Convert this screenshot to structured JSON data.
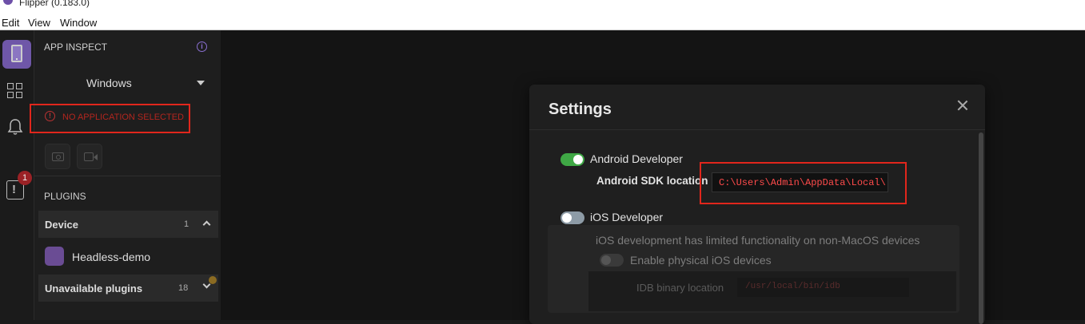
{
  "window": {
    "title": "Flipper (0.183.0)"
  },
  "menu": [
    "Edit",
    "View",
    "Window"
  ],
  "rail": {
    "badge_count": "1"
  },
  "sidebar": {
    "app_inspect_heading": "APP INSPECT",
    "selected_device": "Windows",
    "no_app_text": "NO APPLICATION SELECTED",
    "plugins_heading": "PLUGINS",
    "groups": [
      {
        "label": "Device",
        "count": "1"
      },
      {
        "label": "Unavailable plugins",
        "count": "18"
      }
    ],
    "plugins": [
      {
        "label": "Headless-demo"
      }
    ]
  },
  "settings": {
    "title": "Settings",
    "android": {
      "toggle_label": "Android Developer",
      "enabled": true,
      "sdk_label": "Android SDK location",
      "sdk_value": "C:\\Users\\Admin\\AppData\\Local\\"
    },
    "ios": {
      "toggle_label": "iOS Developer",
      "enabled": false,
      "note": "iOS development has limited functionality on non-MacOS devices",
      "physical_label": "Enable physical iOS devices",
      "idb_label": "IDB binary location",
      "idb_value": "/usr/local/bin/idb"
    }
  },
  "colors": {
    "accent": "#6f57a8",
    "toggle_on": "#3fa845",
    "error": "#b3261e",
    "highlight": "#e1261c"
  }
}
